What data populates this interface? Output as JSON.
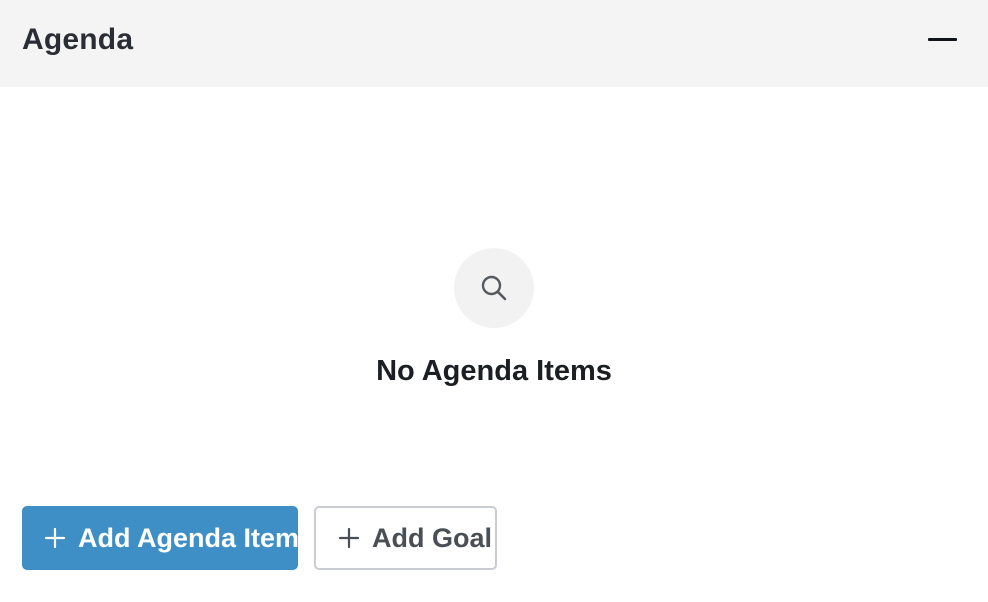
{
  "header": {
    "title": "Agenda",
    "collapse_icon": "minus-icon"
  },
  "empty_state": {
    "icon": "search-icon",
    "message": "No Agenda Items"
  },
  "actions": {
    "add_agenda_item_label": "Add Agenda Item",
    "add_goal_label": "Add Goal",
    "plus_icon": "plus-icon"
  },
  "colors": {
    "header_bg": "#f4f4f4",
    "primary": "#3d8fc6",
    "icon_circle_bg": "#f2f2f2"
  }
}
